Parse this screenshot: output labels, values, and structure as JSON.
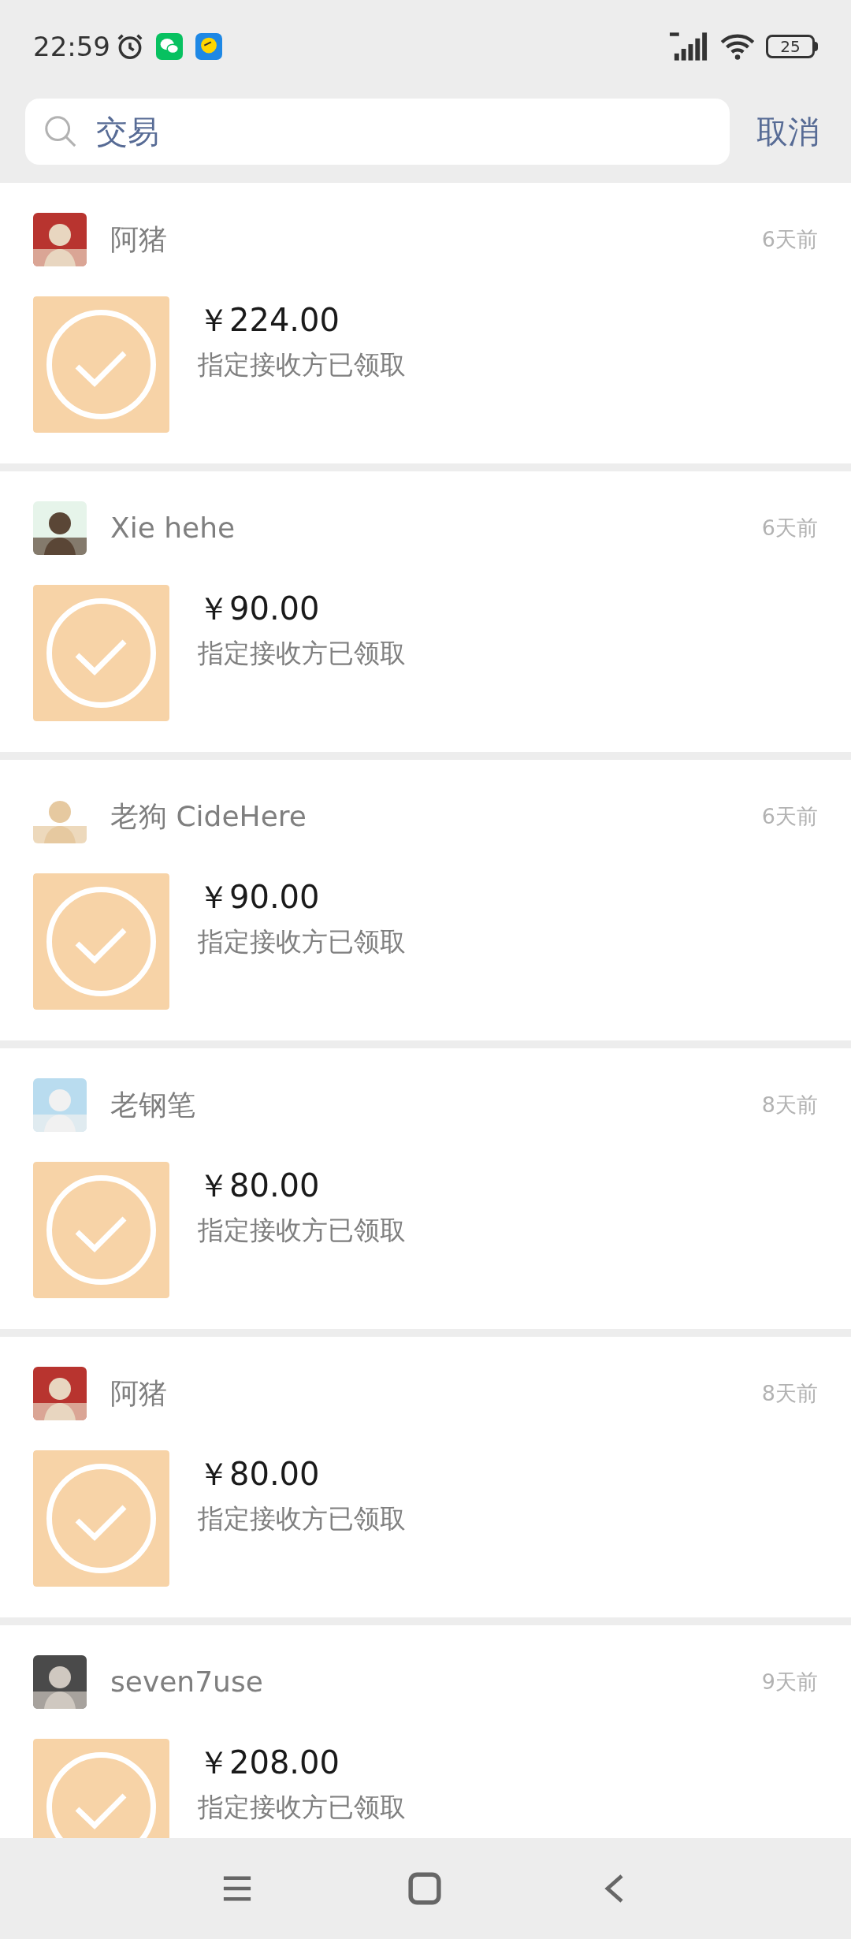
{
  "status_bar": {
    "time": "22:59",
    "battery": "25"
  },
  "search": {
    "value": "交易",
    "cancel": "取消"
  },
  "transactions": [
    {
      "name": "阿猪",
      "time": "6天前",
      "amount": "￥224.00",
      "status": "指定接收方已领取"
    },
    {
      "name": "Xie hehe",
      "time": "6天前",
      "amount": "￥90.00",
      "status": "指定接收方已领取"
    },
    {
      "name": "老狗 CideHere",
      "time": "6天前",
      "amount": "￥90.00",
      "status": "指定接收方已领取"
    },
    {
      "name": "老钢笔",
      "time": "8天前",
      "amount": "￥80.00",
      "status": "指定接收方已领取"
    },
    {
      "name": "阿猪",
      "time": "8天前",
      "amount": "￥80.00",
      "status": "指定接收方已领取"
    },
    {
      "name": "seven7use",
      "time": "9天前",
      "amount": "￥208.00",
      "status": "指定接收方已领取"
    }
  ]
}
